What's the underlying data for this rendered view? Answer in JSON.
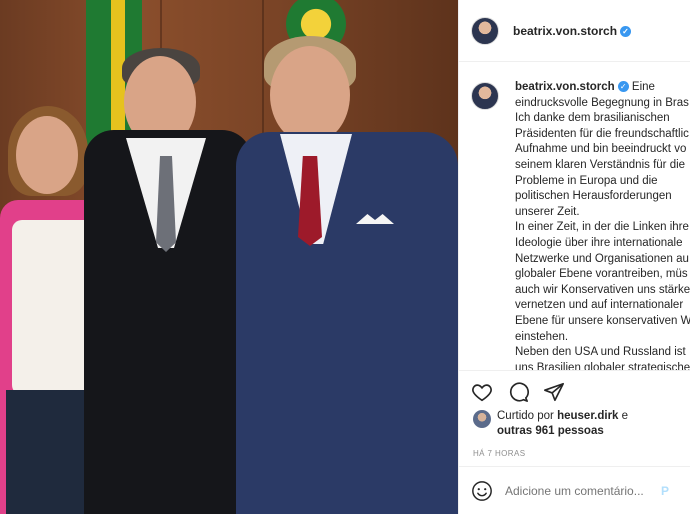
{
  "header": {
    "username": "beatrix.von.storch",
    "verified_icon": "verified-badge-icon"
  },
  "caption": {
    "username": "beatrix.von.storch",
    "lines": [
      " Eine",
      "eindrucksvolle Begegnung in Bras",
      "Ich danke dem brasilianischen",
      "Präsidenten für die freundschaftlic",
      "Aufnahme und bin beeindruckt vo",
      "seinem klaren Verständnis für die",
      "Probleme in Europa und die",
      "politischen Herausforderungen",
      "unserer Zeit.",
      "In einer Zeit, in der die Linken ihre",
      "Ideologie über ihre internationale",
      "Netzwerke und Organisationen au",
      "globaler Ebene vorantreiben, müs",
      "auch wir Konservativen uns stärke",
      "vernetzen und auf internationaler",
      "Ebene für unsere konservativen W",
      "einstehen.",
      "Neben den USA und Russland ist",
      "uns Brasilien globaler strategische"
    ]
  },
  "actions": {
    "icons": [
      "heart-icon",
      "comment-icon",
      "share-icon"
    ]
  },
  "likes": {
    "prefix": "Curtido por",
    "user": "heuser.dirk",
    "conj": "e",
    "others": "outras 961 pessoas"
  },
  "time": "HÁ 7 HORAS",
  "comment": {
    "placeholder": "Adicione um comentário...",
    "post_label": "P"
  },
  "colors": {
    "verified": "#3897f0",
    "border": "#efefef",
    "muted": "#8e8e8e"
  }
}
